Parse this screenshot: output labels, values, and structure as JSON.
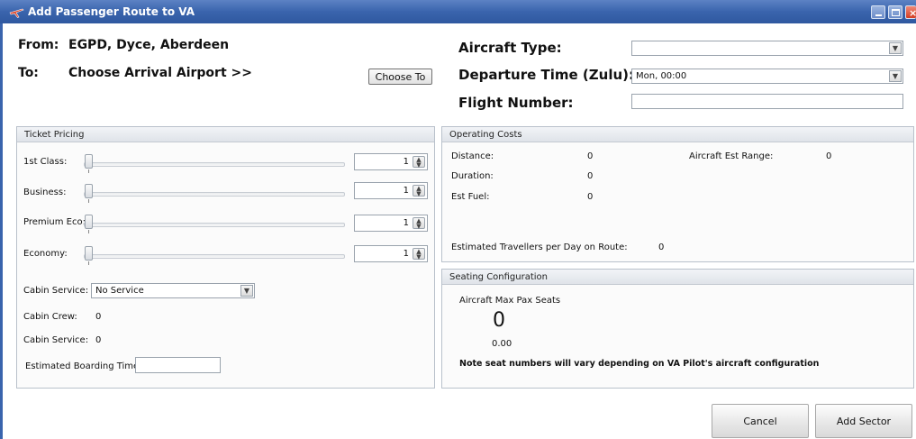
{
  "window": {
    "title": "Add Passenger Route to VA"
  },
  "header": {
    "from_label": "From:",
    "from_value": "EGPD, Dyce, Aberdeen",
    "to_label": "To:",
    "to_value": "Choose Arrival Airport >>",
    "choose_to_button": "Choose To",
    "aircraft_type_label": "Aircraft Type:",
    "aircraft_type_value": "",
    "departure_time_label": "Departure Time (Zulu):",
    "departure_time_value": "Mon, 00:00",
    "flight_number_label": "Flight Number:",
    "flight_number_value": ""
  },
  "ticket_pricing": {
    "title": "Ticket Pricing",
    "classes": [
      {
        "label": "1st Class:",
        "value": "1"
      },
      {
        "label": "Business:",
        "value": "1"
      },
      {
        "label": "Premium Eco:",
        "value": "1"
      },
      {
        "label": "Economy:",
        "value": "1"
      }
    ],
    "cabin_service_label": "Cabin Service:",
    "cabin_service_value": "No Service",
    "cabin_crew_label": "Cabin Crew:",
    "cabin_crew_value": "0",
    "cabin_service_count_label": "Cabin Service:",
    "cabin_service_count_value": "0",
    "boarding_time_label": "Estimated Boarding Time:",
    "boarding_time_value": ""
  },
  "operating_costs": {
    "title": "Operating Costs",
    "distance_label": "Distance:",
    "distance_value": "0",
    "duration_label": "Duration:",
    "duration_value": "0",
    "fuel_label": "Est Fuel:",
    "fuel_value": "0",
    "range_label": "Aircraft Est Range:",
    "range_value": "0",
    "travellers_label": "Estimated Travellers per Day on Route:",
    "travellers_value": "0"
  },
  "seating": {
    "title": "Seating Configuration",
    "max_seats_label": "Aircraft Max Pax Seats",
    "max_seats_value": "0",
    "sub_value": "0.00",
    "note": "Note seat numbers will vary depending on VA Pilot's aircraft configuration"
  },
  "footer": {
    "cancel_button": "Cancel",
    "add_sector_button": "Add Sector"
  },
  "colors": {
    "titlebar": "#3a64ad",
    "panel_header": "#dfe3e9"
  }
}
